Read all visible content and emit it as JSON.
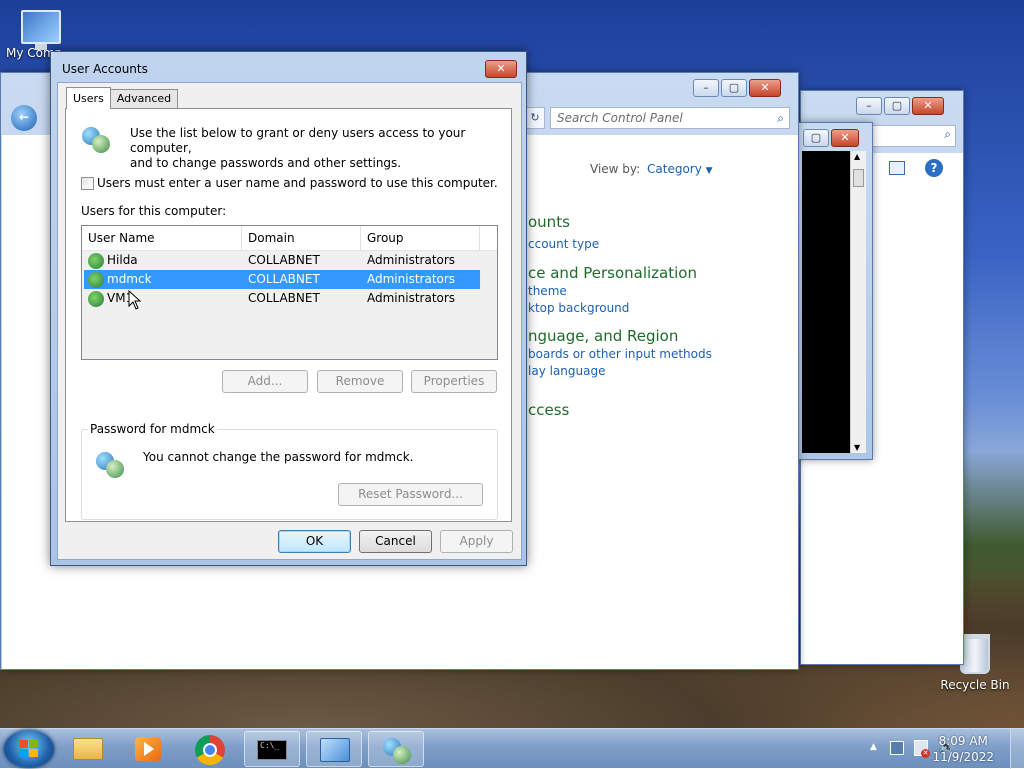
{
  "desktop": {
    "icons": [
      {
        "label": "My Comp"
      },
      {
        "label": "Recycle Bin"
      }
    ]
  },
  "control_panel": {
    "search_placeholder": "Search Control Panel",
    "view_by_label": "View by:",
    "view_by_value": "Category",
    "sections": [
      {
        "heading": "ounts",
        "links": [
          "ccount type"
        ]
      },
      {
        "heading": "ce and Personalization",
        "links": [
          "theme",
          "ktop background"
        ]
      },
      {
        "heading": "nguage, and Region",
        "links": [
          "boards or other input methods",
          "lay language"
        ]
      },
      {
        "heading": "ccess",
        "links": []
      }
    ]
  },
  "dialog": {
    "title": "User Accounts",
    "tabs": [
      {
        "label": "Users",
        "active": true
      },
      {
        "label": "Advanced",
        "active": false
      }
    ],
    "intro_line1": "Use the list below to grant or deny users access to your computer,",
    "intro_line2": "and to change passwords and other settings.",
    "require_login_label": "Users must enter a user name and password to use this computer.",
    "require_login_checked": false,
    "users_label": "Users for this computer:",
    "columns": [
      "User Name",
      "Domain",
      "Group"
    ],
    "users": [
      {
        "name": "Hilda",
        "domain": "COLLABNET",
        "group": "Administrators",
        "selected": false
      },
      {
        "name": "mdmck",
        "domain": "COLLABNET",
        "group": "Administrators",
        "selected": true
      },
      {
        "name": "VM1",
        "domain": "COLLABNET",
        "group": "Administrators",
        "selected": false
      }
    ],
    "add_label": "Add...",
    "remove_label": "Remove",
    "properties_label": "Properties",
    "password_group_label": "Password for mdmck",
    "password_message": "You cannot change the password for mdmck.",
    "reset_password_label": "Reset Password...",
    "ok_label": "OK",
    "cancel_label": "Cancel",
    "apply_label": "Apply"
  },
  "taskbar": {
    "items": [
      "explorer-icon",
      "media-player-icon",
      "chrome-icon",
      "cmd-icon",
      "control-panel-icon",
      "user-accounts-icon"
    ],
    "time": "8:09 AM",
    "date": "11/9/2022"
  }
}
